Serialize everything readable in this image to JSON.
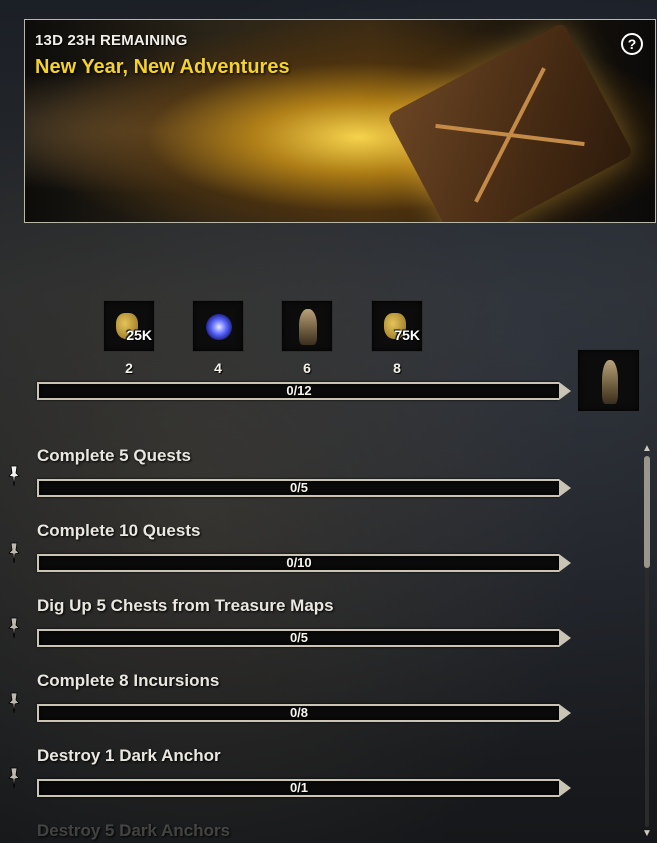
{
  "event": {
    "remaining": "13D 23H REMAINING",
    "title": "New Year, New Adventures",
    "help_icon": "question-circle-icon"
  },
  "milestones": [
    {
      "value": "2",
      "reward_amount": "25K",
      "icon": "gold-bag-icon"
    },
    {
      "value": "4",
      "reward_amount": "",
      "icon": "transmute-crystal-icon"
    },
    {
      "value": "6",
      "reward_amount": "",
      "icon": "statue-icon"
    },
    {
      "value": "8",
      "reward_amount": "75K",
      "icon": "gold-bag-icon"
    }
  ],
  "overall_progress": {
    "label": "0/12",
    "fraction": 0
  },
  "final_reward": {
    "icon": "outfit-figure-icon"
  },
  "tasks": [
    {
      "title": "Complete 5 Quests",
      "progress": "0/5",
      "pinned": true
    },
    {
      "title": "Complete 10 Quests",
      "progress": "0/10",
      "pinned": false
    },
    {
      "title": "Dig Up 5 Chests from Treasure Maps",
      "progress": "0/5",
      "pinned": false
    },
    {
      "title": "Complete 8 Incursions",
      "progress": "0/8",
      "pinned": false
    },
    {
      "title": "Destroy 1 Dark Anchor",
      "progress": "0/1",
      "pinned": false
    },
    {
      "title": "Destroy 5 Dark Anchors",
      "progress": "",
      "pinned": false
    }
  ],
  "colors": {
    "title_gold": "#f5d22a",
    "bar_border": "#c9c4b4"
  }
}
